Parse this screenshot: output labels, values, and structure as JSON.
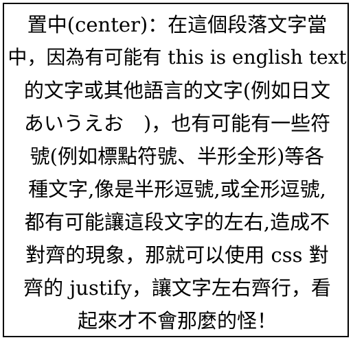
{
  "paragraph": {
    "lines": [
      "置中(center)：在這個段落文字當",
      "中，因為有可能有 this is english text",
      "的文字或其他語言的文字(例如日文",
      "あいうえお　)，也有可能有一些符",
      "號(例如標點符號、半形全形)等各",
      "種文字,像是半形逗號,或全形逗號,",
      "都有可能讓這段文字的左右,造成不",
      "對齊的現象，那就可以使用 css 對",
      "齊的 justify，讓文字左右齊行，看",
      "起來才不會那麼的怪！"
    ]
  }
}
